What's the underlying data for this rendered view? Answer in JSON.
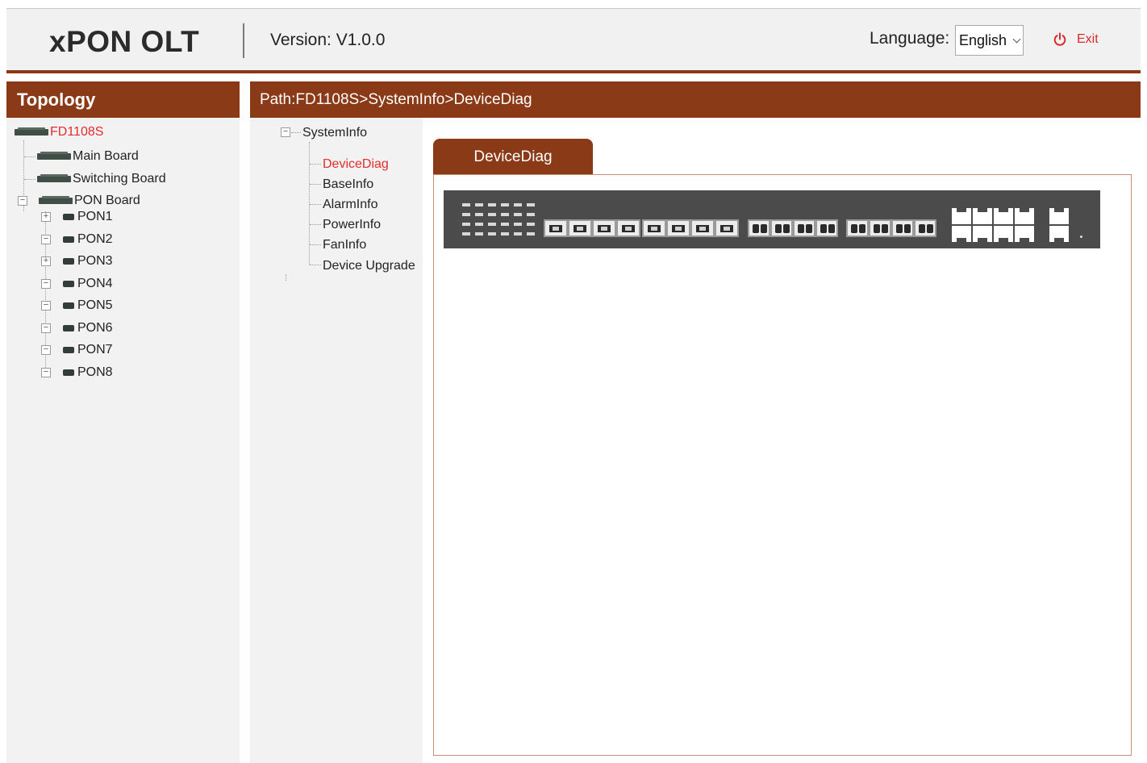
{
  "header": {
    "logo": "xPON OLT",
    "version": "Version: V1.0.0",
    "language_label": "Language:",
    "language_value": "English",
    "exit_label": "Exit"
  },
  "colors": {
    "accent": "#8b3a17",
    "active": "#e52b2b"
  },
  "topology": {
    "title": "Topology",
    "root": "FD1108S",
    "nodes": [
      "Main Board",
      "Switching Board",
      "PON Board"
    ],
    "pon": [
      "PON1",
      "PON2",
      "PON3",
      "PON4",
      "PON5",
      "PON6",
      "PON7",
      "PON8"
    ]
  },
  "path": "Path:FD1108S>SystemInfo>DeviceDiag",
  "menu": {
    "root": "SystemInfo",
    "items": [
      "DeviceDiag",
      "BaseInfo",
      "AlarmInfo",
      "PowerInfo",
      "FanInfo",
      "Device Upgrade"
    ],
    "active": "DeviceDiag"
  },
  "tab": "DeviceDiag"
}
